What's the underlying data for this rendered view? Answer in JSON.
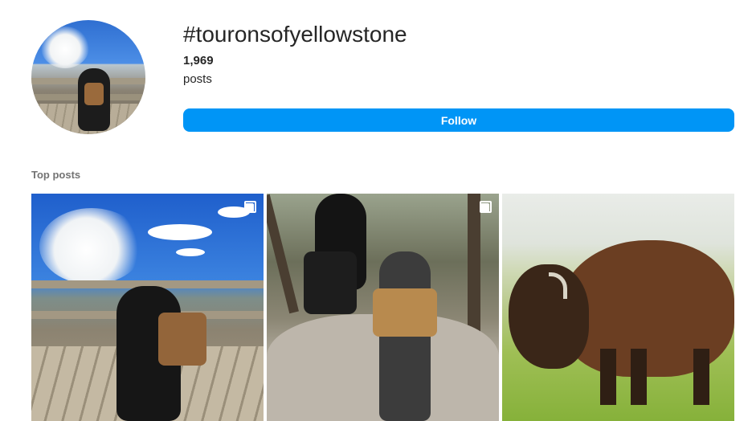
{
  "header": {
    "hashtag": "#touronsofyellowstone",
    "post_count": "1,969",
    "post_count_label": "posts",
    "follow_label": "Follow"
  },
  "top_posts": {
    "title": "Top posts",
    "items": [
      {
        "alt": "dog with saddlebag on boardwalk near geyser",
        "multi": true
      },
      {
        "alt": "person and dog overlooking canyon waterfall",
        "multi": true
      },
      {
        "alt": "bison grazing in meadow",
        "multi": false
      }
    ]
  },
  "colors": {
    "accent": "#0095f6",
    "text_primary": "#262626",
    "text_secondary": "#737373"
  }
}
